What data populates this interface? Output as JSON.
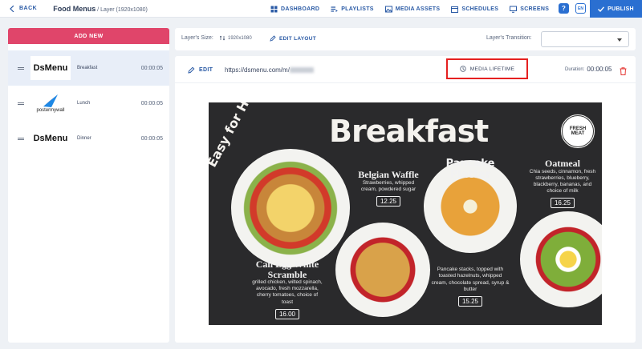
{
  "header": {
    "back_label": "BACK",
    "title": "Food Menus",
    "subtitle": " / Layer (1920x1080)",
    "nav": [
      {
        "label": "DASHBOARD",
        "icon": "dashboard-icon"
      },
      {
        "label": "PLAYLISTS",
        "icon": "playlist-icon"
      },
      {
        "label": "MEDIA ASSETS",
        "icon": "media-icon"
      },
      {
        "label": "SCHEDULES",
        "icon": "calendar-icon"
      },
      {
        "label": "SCREENS",
        "icon": "screen-icon"
      }
    ],
    "help_label": "?",
    "lang_label": "EN",
    "publish_label": "PUBLISH"
  },
  "sidebar": {
    "add_label": "ADD NEW",
    "items": [
      {
        "thumb": "DsMenu",
        "name": "Breakfast",
        "duration": "00:00:05",
        "active": true
      },
      {
        "thumb": "postermywall",
        "name": "Lunch",
        "duration": "00:00:05",
        "active": false
      },
      {
        "thumb": "DsMenu",
        "name": "Dinner",
        "duration": "00:00:05",
        "active": false
      }
    ]
  },
  "toolbar": {
    "size_label": "Layer's Size:",
    "size_value": "1920x1080",
    "edit_layout_label": "EDIT LAYOUT",
    "transition_label": "Layer's Transition:",
    "transition_value": ""
  },
  "media": {
    "edit_label": "EDIT",
    "url": "https://dsmenu.com/m/",
    "lifetime_label": "MEDIA LIFETIME",
    "duration_label": "Duration:",
    "duration_value": "00:00:05"
  },
  "poster": {
    "title": "Breakfast",
    "side_text": "Easy for Here or To-Go",
    "seal_text": "FRESH MEAT",
    "items": [
      {
        "name": "Belgian Waffle",
        "desc": "Strawberries, whipped cream, powdered sugar",
        "price": "12.25"
      },
      {
        "name": "Pancake Platter",
        "desc": "Pancake stacks, topped with toasted hazelnuts, whipped cream, chocolate spread, syrup & butter",
        "price": "15.25"
      },
      {
        "name": "Oatmeal",
        "desc": "Chia seeds, cinnamon, fresh strawberries, blueberry, blackberry, bananas, and choice of milk",
        "price": "16.25"
      },
      {
        "name": "Cali Egg White Scramble",
        "desc": "grilled chicken, wilted spinach, avocado, fresh mozzarella, cherry tomatoes, choice of toast",
        "price": "16.00"
      }
    ]
  },
  "colors": {
    "accent": "#2a6fd1",
    "add_new": "#e0456a",
    "highlight": "#e52020"
  }
}
